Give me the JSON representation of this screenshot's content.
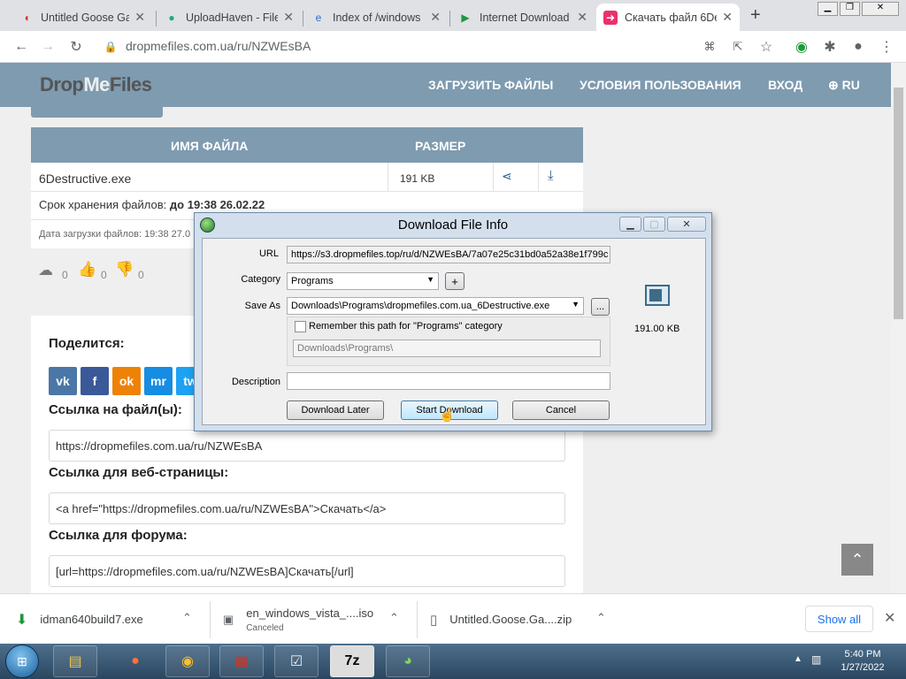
{
  "browser": {
    "tabs": [
      {
        "title": "Untitled Goose Gar"
      },
      {
        "title": "UploadHaven - File"
      },
      {
        "title": "Index of /windows"
      },
      {
        "title": "Internet Download"
      },
      {
        "title": "Скачать файл 6De"
      }
    ],
    "new_tab": "+",
    "url": "dropmefiles.com.ua/ru/NZWEsBA"
  },
  "site": {
    "logo_a": "Drop",
    "logo_b": "Me",
    "logo_c": "Files",
    "nav": [
      "ЗАГРУЗИТЬ ФАЙЛЫ",
      "УСЛОВИЯ ПОЛЬЗОВАНИЯ",
      "ВХОД",
      "RU"
    ]
  },
  "files": {
    "col_name": "ИМЯ ФАЙЛА",
    "col_size": "РАЗМЕР",
    "row": {
      "name": "6Destructive.exe",
      "size": "191 KB"
    },
    "storage_label": "Срок хранения файлов:",
    "storage_value": "до 19:38 26.02.22",
    "upload_date": "Дата загрузки файлов: 19:38 27.0",
    "counts": [
      "0",
      "0",
      "0"
    ]
  },
  "share": {
    "title": "Поделится:",
    "buttons": [
      "vk",
      "f",
      "ok",
      "mr",
      "tw"
    ],
    "file_link_label": "Ссылка на файл(ы):",
    "file_link": "https://dropmefiles.com.ua/ru/NZWEsBA",
    "web_label": "Ссылка для веб-страницы:",
    "web_code": "<a href=\"https://dropmefiles.com.ua/ru/NZWEsBA\">Скачать</a>",
    "forum_label": "Ссылка для форума:",
    "forum_code": "[url=https://dropmefiles.com.ua/ru/NZWEsBA]Скачать[/url]"
  },
  "dialog": {
    "title": "Download File Info",
    "url_label": "URL",
    "url_value": "https://s3.dropmefiles.top/ru/d/NZWEsBA/7a07e25c31bd0a52a38e1f799c",
    "category_label": "Category",
    "category_value": "Programs",
    "plus": "+",
    "saveas_label": "Save As",
    "saveas_value": "Downloads\\Programs\\dropmefiles.com.ua_6Destructive.exe",
    "browse": "...",
    "remember": "Remember this path for \"Programs\" category",
    "path_value": "Downloads\\Programs\\",
    "description_label": "Description",
    "size": "191.00  KB",
    "btn_later": "Download Later",
    "btn_start": "Start Download",
    "btn_cancel": "Cancel"
  },
  "downloads": {
    "items": [
      {
        "name": "idman640build7.exe",
        "status": ""
      },
      {
        "name": "en_windows_vista_....iso",
        "status": "Canceled"
      },
      {
        "name": "Untitled.Goose.Ga....zip",
        "status": ""
      }
    ],
    "show_all": "Show all"
  },
  "taskbar": {
    "time": "5:40 PM",
    "date": "1/27/2022"
  }
}
